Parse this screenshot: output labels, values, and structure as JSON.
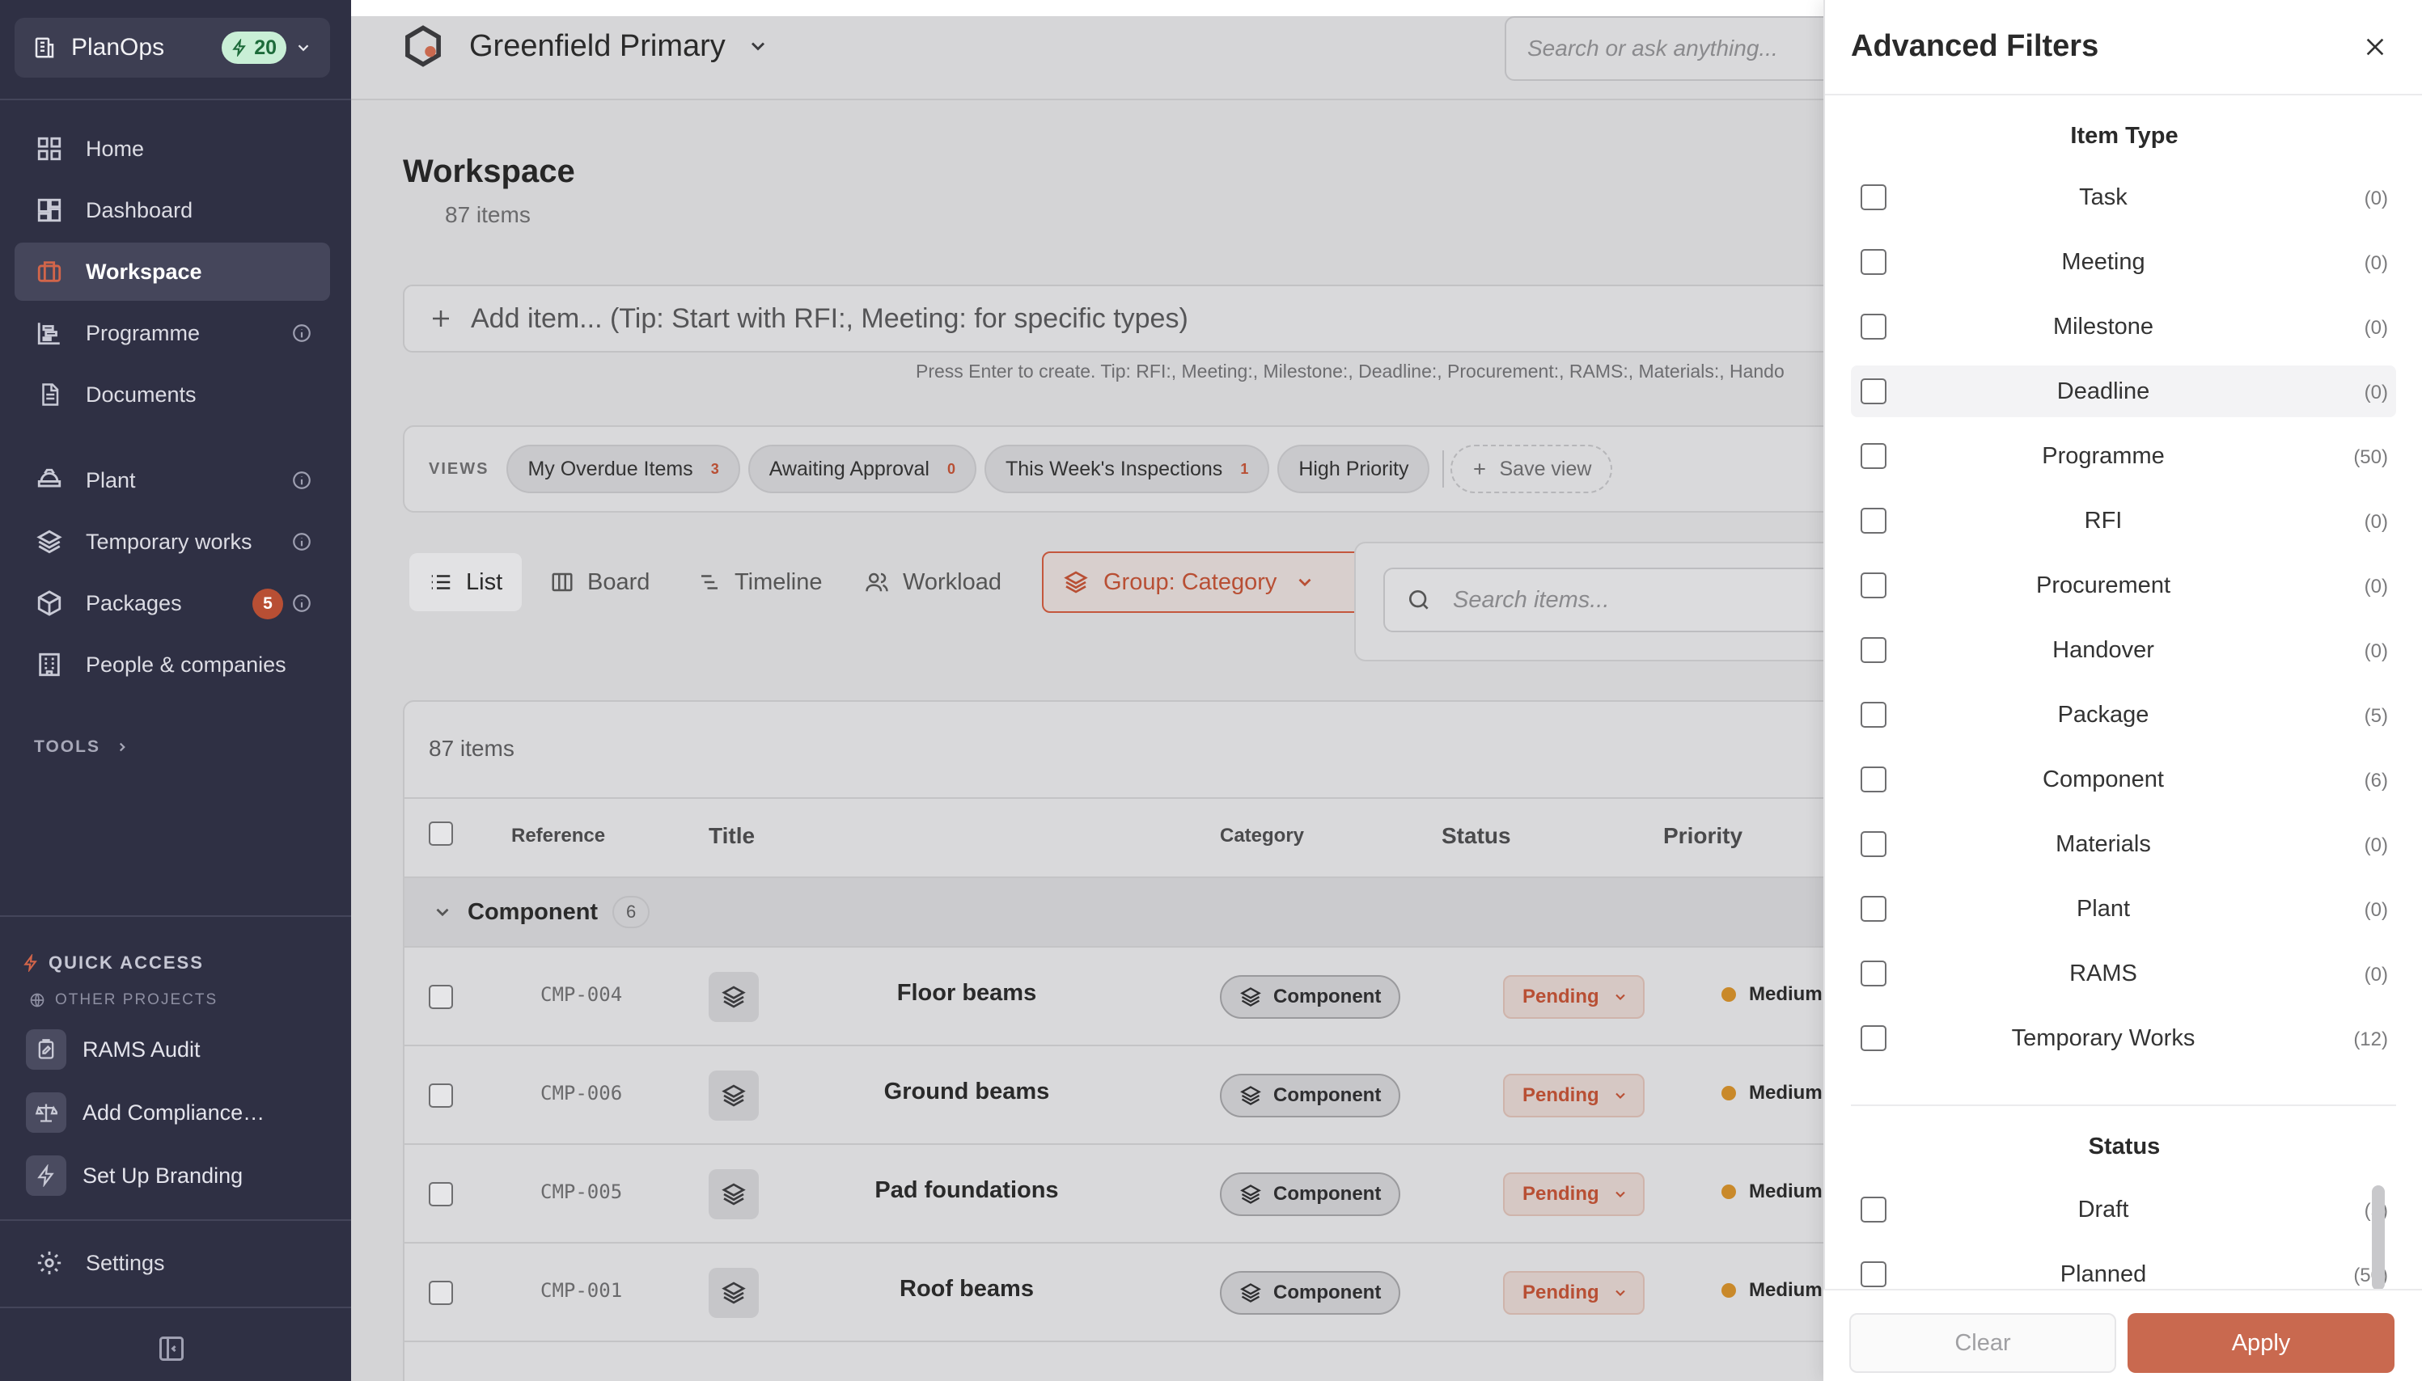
{
  "sidebar": {
    "workspace_name": "PlanOps",
    "credits": "20",
    "nav": [
      {
        "label": "Home",
        "icon": "grid-icon"
      },
      {
        "label": "Dashboard",
        "icon": "dashboard-icon"
      },
      {
        "label": "Workspace",
        "icon": "briefcase-icon",
        "active": true
      },
      {
        "label": "Programme",
        "icon": "gantt-icon"
      },
      {
        "label": "Documents",
        "icon": "document-icon"
      },
      {
        "label": "Plant",
        "icon": "plant-icon"
      },
      {
        "label": "Temporary works",
        "icon": "layers-icon"
      },
      {
        "label": "Packages",
        "icon": "package-icon",
        "badge": "5"
      },
      {
        "label": "People & companies",
        "icon": "building-icon"
      }
    ],
    "tools_label": "TOOLS",
    "quick_access_label": "QUICK ACCESS",
    "other_projects_label": "OTHER PROJECTS",
    "quick_items": [
      {
        "label": "RAMS Audit",
        "icon": "clipboard-edit-icon"
      },
      {
        "label": "Add Compliance…",
        "icon": "scale-icon"
      },
      {
        "label": "Set Up Branding",
        "icon": "bolt-icon"
      }
    ],
    "settings_label": "Settings"
  },
  "topbar": {
    "project_name": "Greenfield Primary",
    "search_placeholder": "Search or ask anything..."
  },
  "workspace": {
    "title": "Workspace",
    "count_label": "87 items",
    "add_placeholder": "Add item... (Tip: Start with RFI:, Meeting: for specific types)",
    "hint": "Press Enter to create. Tip: RFI:, Meeting:, Milestone:, Deadline:, Procurement:, RAMS:, Materials:, Hando",
    "views_label": "VIEWS",
    "views": [
      {
        "label": "My Overdue Items",
        "count": "3"
      },
      {
        "label": "Awaiting Approval",
        "count": "0"
      },
      {
        "label": "This Week's Inspections",
        "count": "1"
      },
      {
        "label": "High Priority",
        "count": ""
      }
    ],
    "save_view_label": "Save view",
    "view_tabs": [
      "List",
      "Board",
      "Timeline",
      "Workload"
    ],
    "group_label": "Group: Category",
    "search_items_placeholder": "Search items..."
  },
  "table": {
    "count_label": "87 items",
    "columns": {
      "reference": "Reference",
      "title": "Title",
      "category": "Category",
      "status": "Status",
      "priority": "Priority"
    },
    "group": {
      "name": "Component",
      "count": "6"
    },
    "rows": [
      {
        "ref": "CMP-004",
        "title": "Floor beams",
        "category": "Component",
        "status": "Pending",
        "priority": "Medium"
      },
      {
        "ref": "CMP-006",
        "title": "Ground beams",
        "category": "Component",
        "status": "Pending",
        "priority": "Medium"
      },
      {
        "ref": "CMP-005",
        "title": "Pad foundations",
        "category": "Component",
        "status": "Pending",
        "priority": "Medium"
      },
      {
        "ref": "CMP-001",
        "title": "Roof beams",
        "category": "Component",
        "status": "Pending",
        "priority": "Medium"
      }
    ]
  },
  "filters": {
    "title": "Advanced Filters",
    "item_type_title": "Item Type",
    "item_types": [
      {
        "label": "Task",
        "count": "(0)"
      },
      {
        "label": "Meeting",
        "count": "(0)"
      },
      {
        "label": "Milestone",
        "count": "(0)"
      },
      {
        "label": "Deadline",
        "count": "(0)"
      },
      {
        "label": "Programme",
        "count": "(50)"
      },
      {
        "label": "RFI",
        "count": "(0)"
      },
      {
        "label": "Procurement",
        "count": "(0)"
      },
      {
        "label": "Handover",
        "count": "(0)"
      },
      {
        "label": "Package",
        "count": "(5)"
      },
      {
        "label": "Component",
        "count": "(6)"
      },
      {
        "label": "Materials",
        "count": "(0)"
      },
      {
        "label": "Plant",
        "count": "(0)"
      },
      {
        "label": "RAMS",
        "count": "(0)"
      },
      {
        "label": "Temporary Works",
        "count": "(12)"
      }
    ],
    "status_title": "Status",
    "statuses": [
      {
        "label": "Draft",
        "count": "(5)"
      },
      {
        "label": "Planned",
        "count": "(50)"
      }
    ],
    "clear_label": "Clear",
    "apply_label": "Apply"
  },
  "colors": {
    "accent": "#c9694f",
    "sidebar": "#2f3044",
    "credit_bg": "#c9efd6",
    "priority_medium": "#c9892a"
  }
}
